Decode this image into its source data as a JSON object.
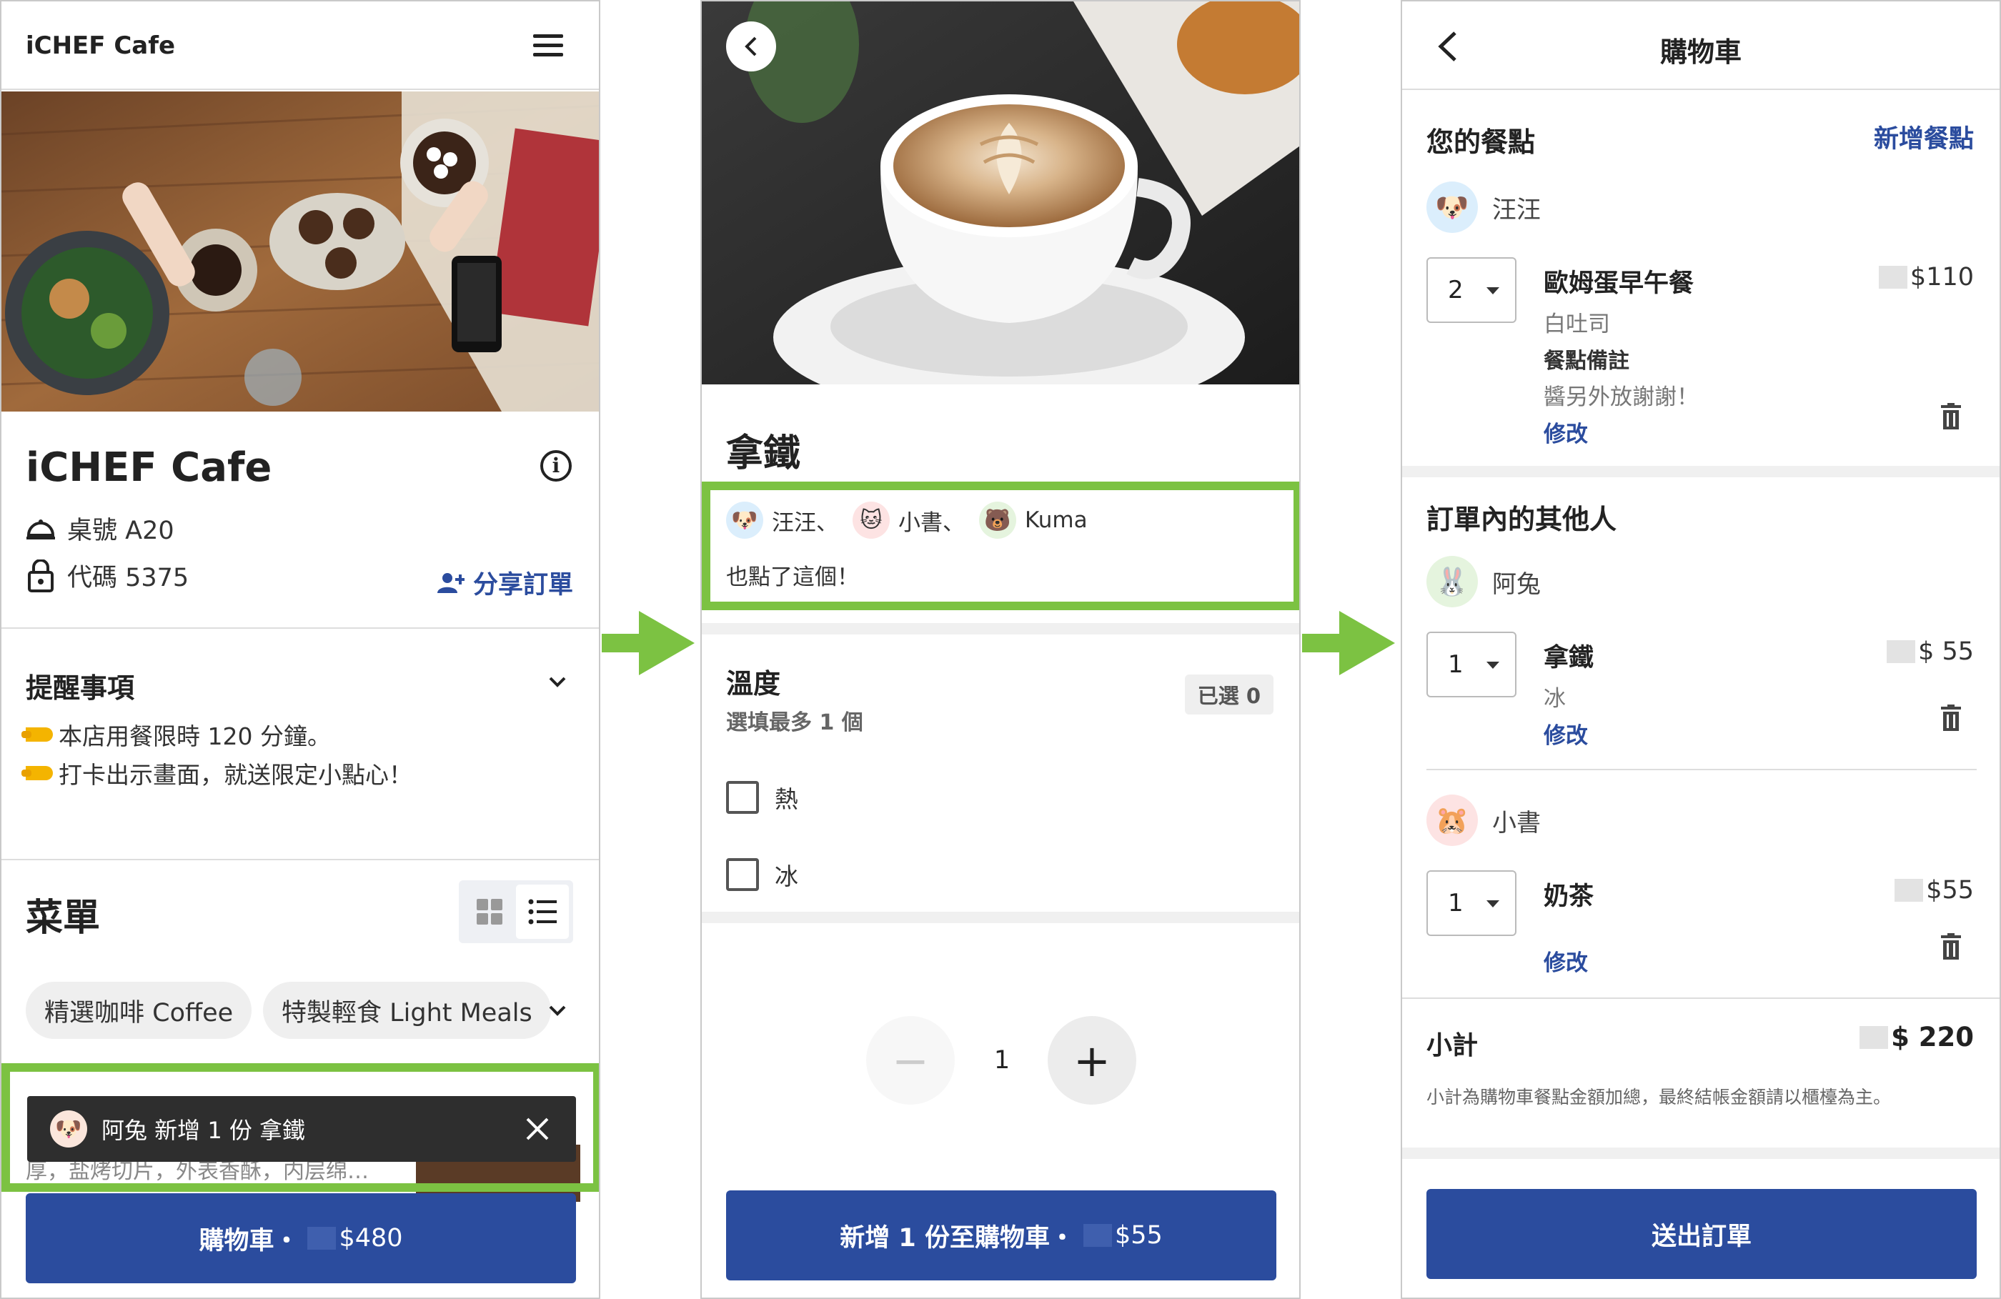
{
  "colors": {
    "brand_blue": "#2b4c9e",
    "highlight_green": "#7cc242",
    "toast_bg": "#2e2e2e"
  },
  "screen1": {
    "logo": "iCHEF Cafe",
    "menu_icon": "hamburger-icon",
    "cafe_name": "iCHEF Cafe",
    "table": "桌號 A20",
    "code": "代碼 5375",
    "share": "分享訂單",
    "reminder_title": "提醒事項",
    "reminders": [
      "本店用餐限時 120 分鐘。",
      "打卡出示畫面，就送限定小點心！"
    ],
    "menu_title": "菜單",
    "categories": [
      "精選咖啡 Coffee",
      "特製輕食 Light Meals"
    ],
    "behind_text": "厚，盐烤切片，外表香酥，内层绵…",
    "toast": "阿兔 新增 1 份 拿鐵",
    "cart_button_label": "購物車・",
    "cart_total": "$480"
  },
  "screen2": {
    "item_name": "拿鐵",
    "also_ordered_names": [
      "汪汪、",
      "小書、",
      "Kuma"
    ],
    "also_ordered_text": "也點了這個！",
    "option_title": "溫度",
    "option_sub": "選填最多 1 個",
    "option_badge": "已選 0",
    "options": [
      "熱",
      "冰"
    ],
    "quantity": "1",
    "minus": "−",
    "plus": "+",
    "add_button_label": "新增 1 份至購物車・",
    "add_price": "$55"
  },
  "screen3": {
    "title": "購物車",
    "your_items": "您的餐點",
    "add_meal": "新增餐點",
    "me": {
      "name": "汪汪",
      "items": [
        {
          "qty": "2",
          "name": "歐姆蛋早午餐",
          "sub": "白吐司",
          "note_label": "餐點備註",
          "note": "醬另外放謝謝！",
          "edit": "修改",
          "price": "$110"
        }
      ]
    },
    "others_title": "訂單內的其他人",
    "others": [
      {
        "name": "阿兔",
        "qty": "1",
        "item": "拿鐵",
        "sub": "冰",
        "edit": "修改",
        "price": "$ 55"
      },
      {
        "name": "小書",
        "qty": "1",
        "item": "奶茶",
        "edit": "修改",
        "price": "$55"
      }
    ],
    "subtotal_label": "小計",
    "subtotal": "$ 220",
    "subtotal_note": "小計為購物車餐點金額加總，最終結帳金額請以櫃檯為主。",
    "submit": "送出訂單"
  }
}
